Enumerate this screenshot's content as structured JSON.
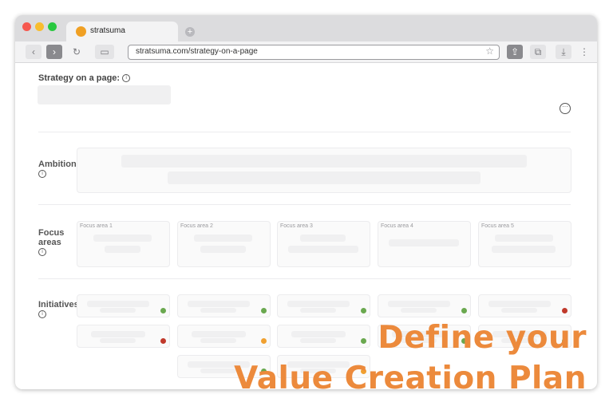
{
  "browser": {
    "tab_title": "stratsuma",
    "new_tab_icon": "plus-icon",
    "url": "stratsuma.com/strategy-on-a-page",
    "nav_icons": [
      "back-icon",
      "forward-icon",
      "reload-icon",
      "sidebar-icon"
    ],
    "right_icons": [
      "share-icon",
      "tabs-icon",
      "download-icon",
      "more-icon"
    ]
  },
  "page": {
    "heading": "Strategy on a page:",
    "sections": {
      "ambition": "Ambition",
      "focus_areas": "Focus areas",
      "initiatives": "Initiatives"
    },
    "focus_areas": [
      "Focus area 1",
      "Focus area 2",
      "Focus area 3",
      "Focus area 4",
      "Focus area 5"
    ]
  },
  "initiative_status": {
    "colors": {
      "green": "#6aa84f",
      "red": "#c0392b",
      "orange": "#f0a030"
    },
    "columns": [
      [
        "green",
        "red"
      ],
      [
        "green",
        "orange",
        "green"
      ],
      [
        "green",
        "green",
        "orange"
      ],
      [
        "green",
        "green"
      ],
      [
        "red",
        "green"
      ]
    ]
  },
  "overlay": {
    "line1": "Define your",
    "line2": "Value Creation Plan",
    "color": "#ec8a3c"
  }
}
